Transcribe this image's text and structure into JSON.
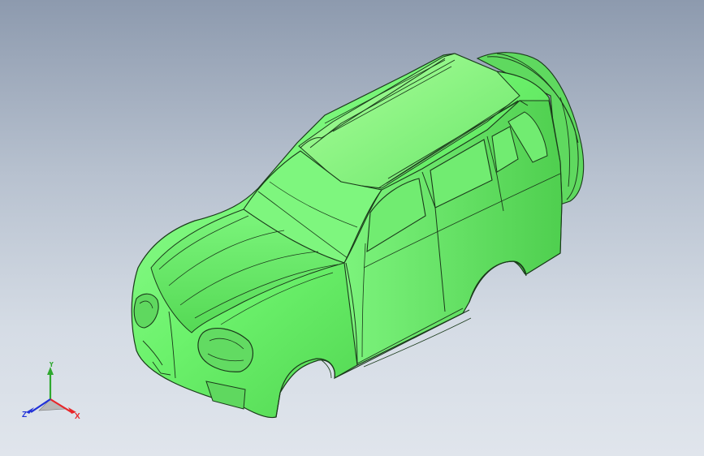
{
  "view": {
    "model": "SUV body shell",
    "shaded_color": "#6cf26c",
    "edge_color": "#1a3a1a",
    "background_top": "#8d9aae",
    "background_bottom": "#e0e5ec"
  },
  "triad": {
    "x_label": "X",
    "y_label": "Y",
    "z_label": "Z",
    "x_color": "#e8262a",
    "y_color": "#2fa82f",
    "z_color": "#2030d8"
  }
}
